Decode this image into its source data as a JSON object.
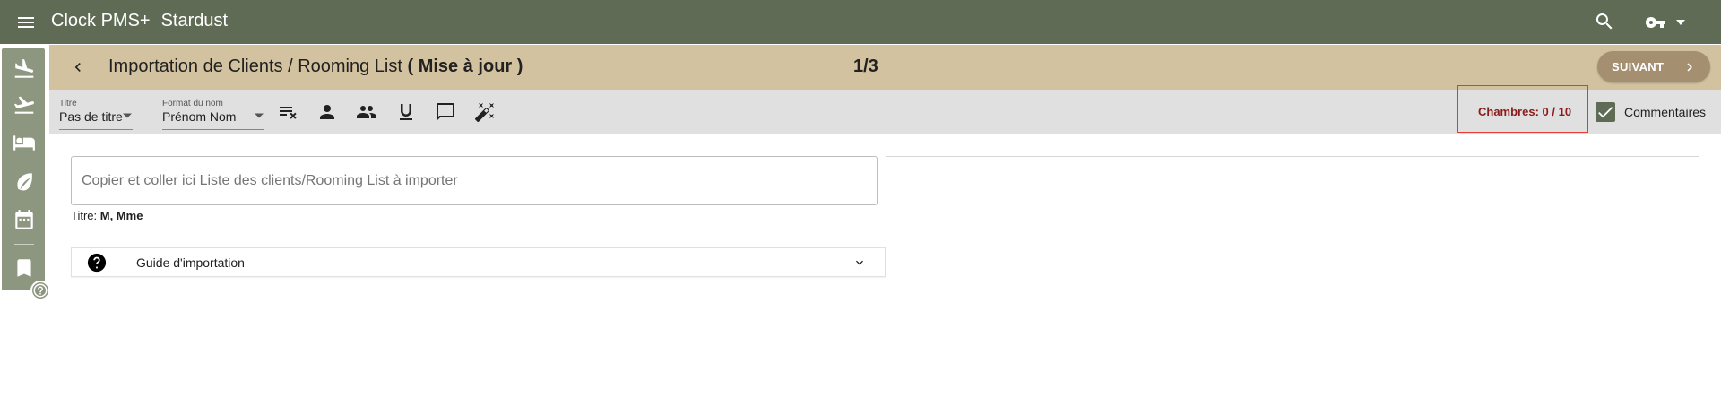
{
  "appbar": {
    "brand": "Clock PMS+",
    "hotel": "Stardust",
    "icons": [
      "menu-icon",
      "search-icon",
      "key-icon",
      "caret-down-icon"
    ]
  },
  "rail": {
    "items": [
      "flight-land-icon",
      "flight-takeoff-icon",
      "hotel-bed-icon",
      "leaf-icon",
      "calendar-icon",
      "book-icon"
    ],
    "help_icon": "help-icon"
  },
  "titlebar": {
    "title_prefix": "Importation de Clients / Rooming List ",
    "title_mode": "( Mise à jour )",
    "step": "1/3",
    "next_label": "SUIVANT"
  },
  "toolbar": {
    "title_select": {
      "caption": "Titre",
      "value": "Pas de titre"
    },
    "name_format_select": {
      "caption": "Format du nom",
      "value": "Prénom Nom"
    },
    "tools": [
      "clear-format-icon",
      "person-icon",
      "people-icon",
      "underline-icon",
      "comment-icon",
      "magic-wand-icon"
    ],
    "rooms": "Chambres: 0 / 10",
    "comments_label": "Commentaires",
    "comments_checked": true
  },
  "content": {
    "paste_placeholder": "Copier et coller ici Liste des clients/Rooming List à importer",
    "titre_label": "Titre: ",
    "titre_values": "M, Mme",
    "guide_label": "Guide d'importation"
  },
  "colors": {
    "appbar": "#5f6b55",
    "rail": "#8d977f",
    "titlebar": "#d3c29f",
    "toolbar": "#e0e0e0",
    "next_button": "#a58f71",
    "rooms_text": "#8b1a1a",
    "highlight_box": "#e53935"
  }
}
